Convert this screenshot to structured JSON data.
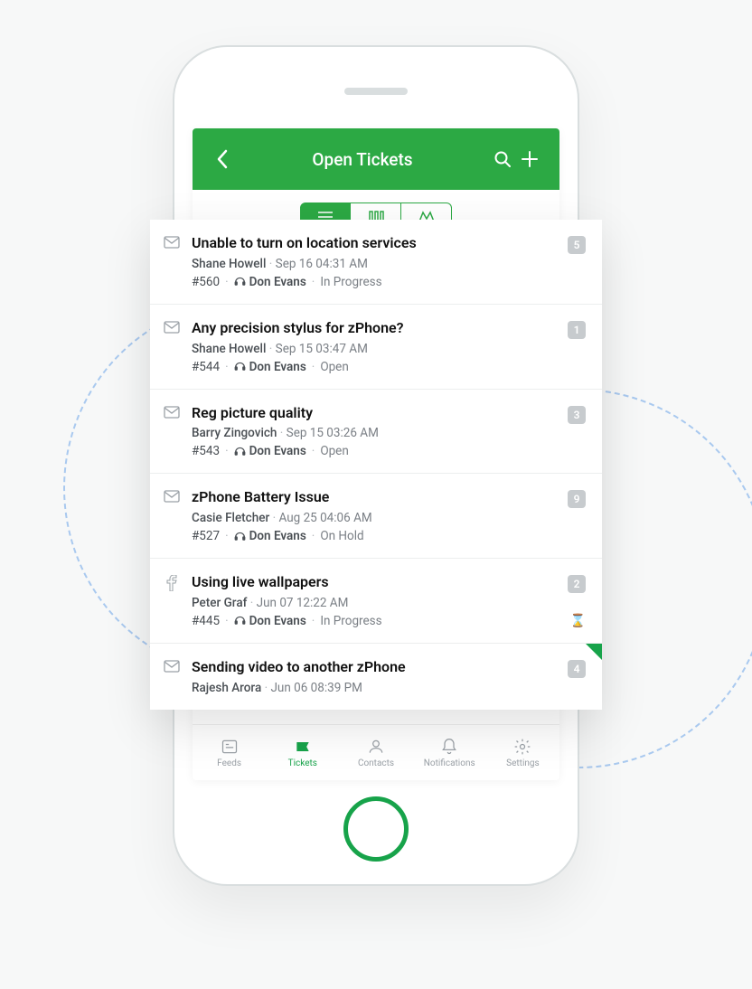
{
  "colors": {
    "brand": "#2ca944",
    "accent": "#17a34a"
  },
  "header": {
    "title": "Open Tickets"
  },
  "tickets": [
    {
      "source": "mail",
      "title": "Unable to turn on location services",
      "requester": "Shane Howell",
      "timestamp": "Sep 16 04:31 AM",
      "id": "#560",
      "agent": "Don Evans",
      "status": "In Progress",
      "count": "5",
      "overdue": false,
      "flag": false
    },
    {
      "source": "mail",
      "title": "Any precision stylus for zPhone?",
      "requester": "Shane Howell",
      "timestamp": "Sep 15 03:47 AM",
      "id": "#544",
      "agent": "Don Evans",
      "status": "Open",
      "count": "1",
      "overdue": false,
      "flag": false
    },
    {
      "source": "mail",
      "title": "Reg picture quality",
      "requester": "Barry Zingovich",
      "timestamp": "Sep 15 03:26 AM",
      "id": "#543",
      "agent": "Don Evans",
      "status": "Open",
      "count": "3",
      "overdue": false,
      "flag": false
    },
    {
      "source": "mail",
      "title": "zPhone Battery Issue",
      "requester": "Casie Fletcher",
      "timestamp": "Aug 25 04:06 AM",
      "id": "#527",
      "agent": "Don Evans",
      "status": "On Hold",
      "count": "9",
      "overdue": false,
      "flag": false
    },
    {
      "source": "facebook",
      "title": "Using live wallpapers",
      "requester": "Peter Graf",
      "timestamp": "Jun 07 12:22 AM",
      "id": "#445",
      "agent": "Don Evans",
      "status": "In Progress",
      "count": "2",
      "overdue": true,
      "flag": false
    },
    {
      "source": "mail",
      "title": "Sending video to another zPhone",
      "requester": "Rajesh Arora",
      "timestamp": "Jun 06 08:39 PM",
      "id": "",
      "agent": "",
      "status": "",
      "count": "4",
      "overdue": false,
      "flag": true
    }
  ],
  "bottom_nav": {
    "feeds": "Feeds",
    "tickets": "Tickets",
    "contacts": "Contacts",
    "notifications": "Notifications",
    "settings": "Settings"
  }
}
